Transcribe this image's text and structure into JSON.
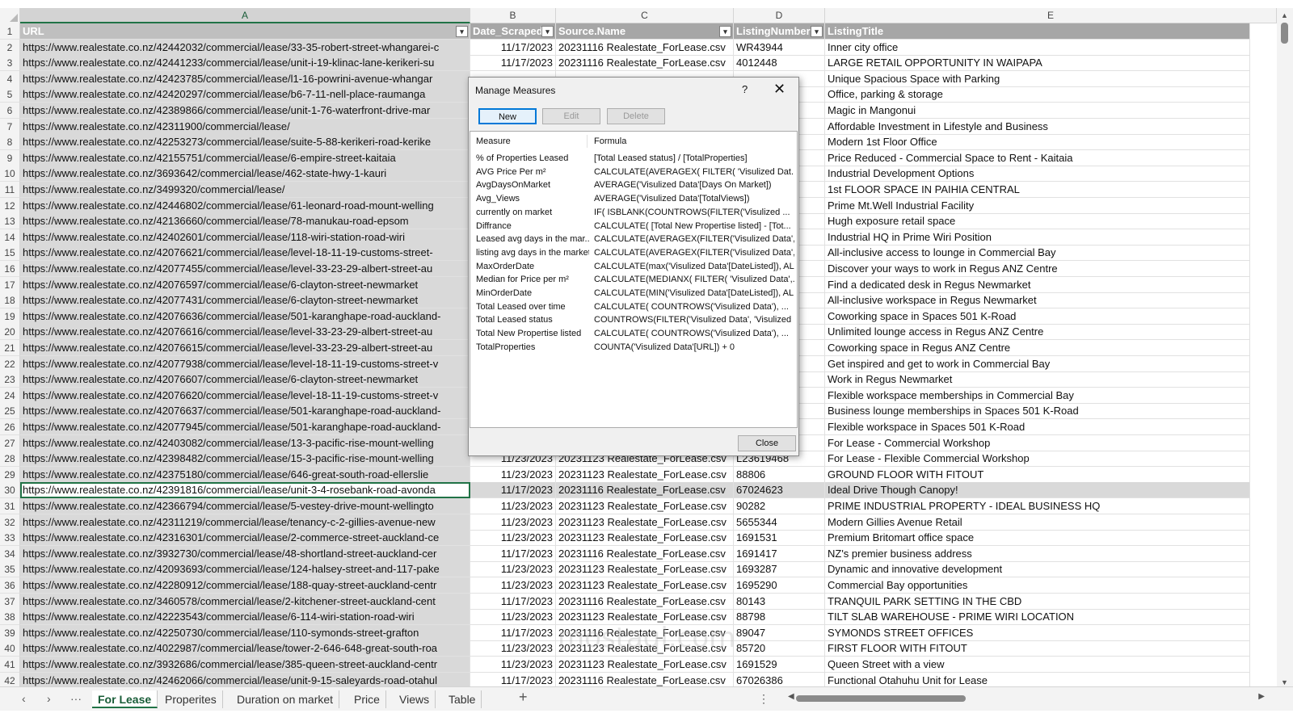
{
  "columns": [
    "A",
    "B",
    "C",
    "D",
    "E"
  ],
  "header_row": {
    "rownum": "1",
    "a": "URL",
    "b": "Date_Scraped",
    "c": "Source.Name",
    "d": "ListingNumber",
    "e": "ListingTitle"
  },
  "rows": [
    {
      "rn": "2",
      "a": "https://www.realestate.co.nz/42442032/commercial/lease/33-35-robert-street-whangarei-c",
      "b": "11/17/2023",
      "c": "20231116 Realestate_ForLease.csv",
      "d": "WR43944",
      "e": "Inner city office"
    },
    {
      "rn": "3",
      "a": "https://www.realestate.co.nz/42441233/commercial/lease/unit-i-19-klinac-lane-kerikeri-su",
      "b": "11/17/2023",
      "c": "20231116 Realestate_ForLease.csv",
      "d": "4012448",
      "e": "LARGE RETAIL OPPORTUNITY IN WAIPAPA"
    },
    {
      "rn": "4",
      "a": "https://www.realestate.co.nz/42423785/commercial/lease/l1-16-powrini-avenue-whangar",
      "b": "",
      "c": "",
      "d": "",
      "e": "Unique Spacious Space with Parking"
    },
    {
      "rn": "5",
      "a": "https://www.realestate.co.nz/42420297/commercial/lease/b6-7-11-nell-place-raumanga",
      "b": "",
      "c": "",
      "d": "",
      "e": "Office, parking & storage"
    },
    {
      "rn": "6",
      "a": "https://www.realestate.co.nz/42389866/commercial/lease/unit-1-76-waterfront-drive-mar",
      "b": "",
      "c": "",
      "d": "",
      "e": "Magic in Mangonui"
    },
    {
      "rn": "7",
      "a": "https://www.realestate.co.nz/42311900/commercial/lease/",
      "b": "",
      "c": "",
      "d": "",
      "e": "Affordable Investment in Lifestyle and Business"
    },
    {
      "rn": "8",
      "a": "https://www.realestate.co.nz/42253273/commercial/lease/suite-5-88-kerikeri-road-kerike",
      "b": "",
      "c": "",
      "d": "",
      "e": "Modern 1st Floor Office"
    },
    {
      "rn": "9",
      "a": "https://www.realestate.co.nz/42155751/commercial/lease/6-empire-street-kaitaia",
      "b": "",
      "c": "",
      "d": "",
      "e": "Price Reduced - Commercial Space to Rent - Kaitaia"
    },
    {
      "rn": "10",
      "a": "https://www.realestate.co.nz/3693642/commercial/lease/462-state-hwy-1-kauri",
      "b": "",
      "c": "",
      "d": "",
      "e": "Industrial Development Options"
    },
    {
      "rn": "11",
      "a": "https://www.realestate.co.nz/3499320/commercial/lease/",
      "b": "",
      "c": "",
      "d": "",
      "e": "1st FLOOR SPACE IN PAIHIA CENTRAL"
    },
    {
      "rn": "12",
      "a": "https://www.realestate.co.nz/42446802/commercial/lease/61-leonard-road-mount-welling",
      "b": "",
      "c": "",
      "d": "",
      "e": "Prime Mt.Well Industrial Facility"
    },
    {
      "rn": "13",
      "a": "https://www.realestate.co.nz/42136660/commercial/lease/78-manukau-road-epsom",
      "b": "",
      "c": "",
      "d": "",
      "e": "Hugh exposure retail space"
    },
    {
      "rn": "14",
      "a": "https://www.realestate.co.nz/42402601/commercial/lease/118-wiri-station-road-wiri",
      "b": "",
      "c": "",
      "d": "",
      "e": "Industrial HQ in Prime Wiri Position"
    },
    {
      "rn": "15",
      "a": "https://www.realestate.co.nz/42076621/commercial/lease/level-18-11-19-customs-street-",
      "b": "",
      "c": "",
      "d": "",
      "e": "All-inclusive access to lounge in Commercial Bay"
    },
    {
      "rn": "16",
      "a": "https://www.realestate.co.nz/42077455/commercial/lease/level-33-23-29-albert-street-au",
      "b": "",
      "c": "",
      "d": "",
      "e": "Discover your ways to work in Regus ANZ Centre"
    },
    {
      "rn": "17",
      "a": "https://www.realestate.co.nz/42076597/commercial/lease/6-clayton-street-newmarket",
      "b": "",
      "c": "",
      "d": "",
      "e": "Find a dedicated desk in Regus Newmarket"
    },
    {
      "rn": "18",
      "a": "https://www.realestate.co.nz/42077431/commercial/lease/6-clayton-street-newmarket",
      "b": "",
      "c": "",
      "d": "",
      "e": "All-inclusive workspace in Regus Newmarket"
    },
    {
      "rn": "19",
      "a": "https://www.realestate.co.nz/42076636/commercial/lease/501-karanghape-road-auckland-",
      "b": "",
      "c": "",
      "d": "",
      "e": "Coworking space in Spaces 501 K-Road"
    },
    {
      "rn": "20",
      "a": "https://www.realestate.co.nz/42076616/commercial/lease/level-33-23-29-albert-street-au",
      "b": "",
      "c": "",
      "d": "",
      "e": "Unlimited lounge access in Regus ANZ Centre"
    },
    {
      "rn": "21",
      "a": "https://www.realestate.co.nz/42076615/commercial/lease/level-33-23-29-albert-street-au",
      "b": "",
      "c": "",
      "d": "",
      "e": "Coworking space in Regus ANZ Centre"
    },
    {
      "rn": "22",
      "a": "https://www.realestate.co.nz/42077938/commercial/lease/level-18-11-19-customs-street-v",
      "b": "",
      "c": "",
      "d": "",
      "e": "Get inspired and get to work in Commercial Bay"
    },
    {
      "rn": "23",
      "a": "https://www.realestate.co.nz/42076607/commercial/lease/6-clayton-street-newmarket",
      "b": "",
      "c": "",
      "d": "",
      "e": "Work in Regus Newmarket"
    },
    {
      "rn": "24",
      "a": "https://www.realestate.co.nz/42076620/commercial/lease/level-18-11-19-customs-street-v",
      "b": "",
      "c": "",
      "d": "",
      "e": "Flexible workspace memberships in Commercial Bay"
    },
    {
      "rn": "25",
      "a": "https://www.realestate.co.nz/42076637/commercial/lease/501-karanghape-road-auckland-",
      "b": "",
      "c": "",
      "d": "",
      "e": "Business lounge memberships in Spaces 501 K-Road"
    },
    {
      "rn": "26",
      "a": "https://www.realestate.co.nz/42077945/commercial/lease/501-karanghape-road-auckland-",
      "b": "",
      "c": "",
      "d": "",
      "e": "Flexible workspace in Spaces 501 K-Road"
    },
    {
      "rn": "27",
      "a": "https://www.realestate.co.nz/42403082/commercial/lease/13-3-pacific-rise-mount-welling",
      "b": "",
      "c": "",
      "d": "",
      "e": "For Lease - Commercial Workshop"
    },
    {
      "rn": "28",
      "a": "https://www.realestate.co.nz/42398482/commercial/lease/15-3-pacific-rise-mount-welling",
      "b": "11/23/2023",
      "c": "20231123 Realestate_ForLease.csv",
      "d": "L23619468",
      "e": "For Lease - Flexible Commercial Workshop"
    },
    {
      "rn": "29",
      "a": "https://www.realestate.co.nz/42375180/commercial/lease/646-great-south-road-ellerslie",
      "b": "11/23/2023",
      "c": "20231123 Realestate_ForLease.csv",
      "d": "88806",
      "e": "GROUND FLOOR WITH FITOUT"
    },
    {
      "rn": "30",
      "a": "https://www.realestate.co.nz/42391816/commercial/lease/unit-3-4-rosebank-road-avonda",
      "b": "11/17/2023",
      "c": "20231116 Realestate_ForLease.csv",
      "d": "67024623",
      "e": "Ideal Drive Though Canopy!"
    },
    {
      "rn": "31",
      "a": "https://www.realestate.co.nz/42366794/commercial/lease/5-vestey-drive-mount-wellingto",
      "b": "11/23/2023",
      "c": "20231123 Realestate_ForLease.csv",
      "d": "90282",
      "e": "PRIME INDUSTRIAL PROPERTY - IDEAL BUSINESS HQ"
    },
    {
      "rn": "32",
      "a": "https://www.realestate.co.nz/42311219/commercial/lease/tenancy-c-2-gillies-avenue-new",
      "b": "11/23/2023",
      "c": "20231123 Realestate_ForLease.csv",
      "d": "5655344",
      "e": "Modern Gillies Avenue Retail"
    },
    {
      "rn": "33",
      "a": "https://www.realestate.co.nz/42316301/commercial/lease/2-commerce-street-auckland-ce",
      "b": "11/23/2023",
      "c": "20231123 Realestate_ForLease.csv",
      "d": "1691531",
      "e": "Premium Britomart office space"
    },
    {
      "rn": "34",
      "a": "https://www.realestate.co.nz/3932730/commercial/lease/48-shortland-street-auckland-cer",
      "b": "11/17/2023",
      "c": "20231116 Realestate_ForLease.csv",
      "d": "1691417",
      "e": "NZ's premier business address"
    },
    {
      "rn": "35",
      "a": "https://www.realestate.co.nz/42093693/commercial/lease/124-halsey-street-and-117-pake",
      "b": "11/23/2023",
      "c": "20231123 Realestate_ForLease.csv",
      "d": "1693287",
      "e": "Dynamic and innovative development"
    },
    {
      "rn": "36",
      "a": "https://www.realestate.co.nz/42280912/commercial/lease/188-quay-street-auckland-centr",
      "b": "11/23/2023",
      "c": "20231123 Realestate_ForLease.csv",
      "d": "1695290",
      "e": "Commercial Bay opportunities"
    },
    {
      "rn": "37",
      "a": "https://www.realestate.co.nz/3460578/commercial/lease/2-kitchener-street-auckland-cent",
      "b": "11/17/2023",
      "c": "20231116 Realestate_ForLease.csv",
      "d": "80143",
      "e": "TRANQUIL PARK SETTING IN THE CBD"
    },
    {
      "rn": "38",
      "a": "https://www.realestate.co.nz/42223543/commercial/lease/6-114-wiri-station-road-wiri",
      "b": "11/23/2023",
      "c": "20231123 Realestate_ForLease.csv",
      "d": "88798",
      "e": "TILT SLAB WAREHOUSE - PRIME WIRI LOCATION"
    },
    {
      "rn": "39",
      "a": "https://www.realestate.co.nz/42250730/commercial/lease/110-symonds-street-grafton",
      "b": "11/17/2023",
      "c": "20231116 Realestate_ForLease.csv",
      "d": "89047",
      "e": "SYMONDS STREET OFFICES"
    },
    {
      "rn": "40",
      "a": "https://www.realestate.co.nz/4022987/commercial/lease/tower-2-646-648-great-south-roa",
      "b": "11/23/2023",
      "c": "20231123 Realestate_ForLease.csv",
      "d": "85720",
      "e": "FIRST FLOOR WITH FITOUT"
    },
    {
      "rn": "41",
      "a": "https://www.realestate.co.nz/3932686/commercial/lease/385-queen-street-auckland-centr",
      "b": "11/23/2023",
      "c": "20231123 Realestate_ForLease.csv",
      "d": "1691529",
      "e": "Queen Street with a view"
    },
    {
      "rn": "42",
      "a": "https://www.realestate.co.nz/42462066/commercial/lease/unit-9-15-saleyards-road-otahul",
      "b": "11/17/2023",
      "c": "20231116 Realestate_ForLease.csv",
      "d": "67026386",
      "e": "Functional Otahuhu Unit for Lease"
    }
  ],
  "dialog": {
    "title": "Manage Measures",
    "help": "?",
    "close_x": "✕",
    "btn_new": "New",
    "btn_edit": "Edit",
    "btn_delete": "Delete",
    "col_measure": "Measure",
    "col_formula": "Formula",
    "btn_close": "Close",
    "measures": [
      {
        "name": "% of Properties Leased",
        "formula": "[Total Leased status] / [TotalProperties]"
      },
      {
        "name": "AVG Price Per m²",
        "formula": "CALCULATE(AVERAGEX( FILTER( 'Visulized Dat..."
      },
      {
        "name": "AvgDaysOnMarket",
        "formula": "AVERAGE('Visulized Data'[Days On Market])"
      },
      {
        "name": "Avg_Views",
        "formula": "AVERAGE('Visulized Data'[TotalViews])"
      },
      {
        "name": "currently on market",
        "formula": "IF(    ISBLANK(COUNTROWS(FILTER('Visulized ..."
      },
      {
        "name": "Diffrance",
        "formula": "CALCULATE(     [Total New Propertise listed] - [Tot..."
      },
      {
        "name": "Leased avg days in the mar...",
        "formula": "CALCULATE(AVERAGEX(FILTER('Visulized Data',..."
      },
      {
        "name": "listing avg days in the market",
        "formula": "CALCULATE(AVERAGEX(FILTER('Visulized Data',..."
      },
      {
        "name": "MaxOrderDate",
        "formula": "CALCULATE(max('Visulized Data'[DateListed]), AL..."
      },
      {
        "name": "Median for Price per m²",
        "formula": "CALCULATE(MEDIANX(  FILTER( 'Visulized Data',..."
      },
      {
        "name": "MinOrderDate",
        "formula": "CALCULATE(MIN('Visulized Data'[DateListed]), AL..."
      },
      {
        "name": "Total Leased over time",
        "formula": "CALCULATE(     COUNTROWS('Visulized Data'),    ..."
      },
      {
        "name": "Total Leased status",
        "formula": "COUNTROWS(FILTER('Visulized Data', 'Visulized ..."
      },
      {
        "name": "Total New Propertise listed",
        "formula": "CALCULATE(     COUNTROWS('Visulized Data'),    ..."
      },
      {
        "name": "TotalProperties",
        "formula": "COUNTA('Visulized Data'[URL]) + 0"
      }
    ]
  },
  "tabs": [
    "For Lease",
    "Properites",
    "Duration on market",
    "Price",
    "Views",
    "Table"
  ],
  "active_tab": "For Lease",
  "tab_nav": {
    "prev": "‹",
    "next": "›",
    "more": "···",
    "add": "+",
    "options": "⋮"
  },
  "watermark": "mostaql.com"
}
